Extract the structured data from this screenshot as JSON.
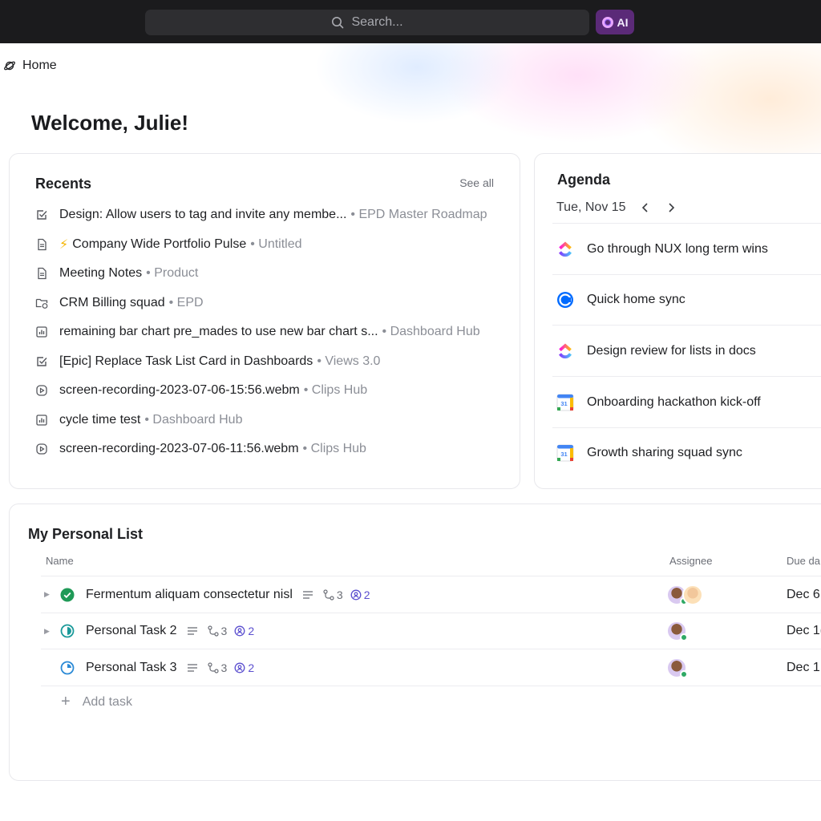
{
  "topbar": {
    "search_placeholder": "Search...",
    "ai_label": "AI"
  },
  "breadcrumb": {
    "label": "Home"
  },
  "welcome": "Welcome, Julie!",
  "recents": {
    "title": "Recents",
    "see_all": "See all",
    "items": [
      {
        "icon": "task-check-icon",
        "name": "Design: Allow users to tag and invite any membe...",
        "location": "• EPD Master Roadmap"
      },
      {
        "icon": "doc-icon",
        "name": "Company Wide Portfolio Pulse",
        "location": "• Untitled",
        "prefix_icon": "lightning-icon"
      },
      {
        "icon": "doc-icon",
        "name": "Meeting Notes",
        "location": "• Product"
      },
      {
        "icon": "folder-sync-icon",
        "name": "CRM Billing squad",
        "location": "• EPD"
      },
      {
        "icon": "bar-chart-icon",
        "name": "remaining bar chart pre_mades to use new bar chart s...",
        "location": "• Dashboard Hub"
      },
      {
        "icon": "task-check-icon",
        "name": "[Epic] Replace Task List Card in Dashboards",
        "location": "• Views 3.0"
      },
      {
        "icon": "play-icon",
        "name": "screen-recording-2023-07-06-15:56.webm",
        "location": "• Clips Hub"
      },
      {
        "icon": "bar-chart-icon",
        "name": "cycle time test",
        "location": "• Dashboard Hub"
      },
      {
        "icon": "play-icon",
        "name": "screen-recording-2023-07-06-11:56.webm",
        "location": "• Clips Hub"
      }
    ]
  },
  "agenda": {
    "title": "Agenda",
    "date": "Tue, Nov 15",
    "events": [
      {
        "icon": "clickup-logo-icon",
        "title": "Go through NUX long term wins"
      },
      {
        "icon": "calendly-logo-icon",
        "title": "Quick home sync"
      },
      {
        "icon": "clickup-logo-icon",
        "title": "Design review for lists in docs"
      },
      {
        "icon": "google-calendar-icon",
        "title": "Onboarding hackathon kick-off",
        "day": "31"
      },
      {
        "icon": "google-calendar-icon",
        "title": "Growth sharing squad sync",
        "day": "31"
      }
    ]
  },
  "personal_list": {
    "title": "My Personal List",
    "columns": {
      "name": "Name",
      "assignee": "Assignee",
      "due": "Due da"
    },
    "tasks": [
      {
        "status": "complete",
        "name": "Fermentum aliquam consectetur nisl",
        "subtasks": "3",
        "assigned": "2",
        "due": "Dec 6",
        "avatars": 2
      },
      {
        "status": "in-progress",
        "name": "Personal Task 2",
        "subtasks": "3",
        "assigned": "2",
        "due": "Dec 1(",
        "avatars": 1
      },
      {
        "status": "todo",
        "name": "Personal Task 3",
        "subtasks": "3",
        "assigned": "2",
        "due": "Dec 1",
        "avatars": 1
      }
    ],
    "add_task": "Add task"
  },
  "colors": {
    "topbar": "#1b1b1d",
    "accent_purple": "#5b4fcf",
    "complete_green": "#1f9a57",
    "progress_teal": "#1b9a9a"
  }
}
